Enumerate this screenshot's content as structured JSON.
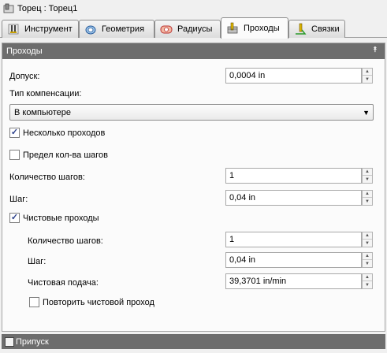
{
  "window": {
    "title": "Торец : Торец1"
  },
  "tabs": [
    {
      "label": "Инструмент",
      "icon": "tool-icon"
    },
    {
      "label": "Геометрия",
      "icon": "geometry-icon"
    },
    {
      "label": "Радиусы",
      "icon": "radius-icon"
    },
    {
      "label": "Проходы",
      "icon": "passes-icon",
      "active": true
    },
    {
      "label": "Связки",
      "icon": "links-icon"
    }
  ],
  "passes": {
    "header": "Проходы",
    "tolerance": {
      "label": "Допуск:",
      "value": "0,0004 in"
    },
    "compensation": {
      "label": "Тип компенсации:",
      "value": "В компьютере"
    },
    "multiple_passes": {
      "label": "Несколько проходов",
      "checked": true
    },
    "step_limit": {
      "label": "Предел кол-ва шагов",
      "checked": false
    },
    "step_count": {
      "label": "Количество шагов:",
      "value": "1"
    },
    "step": {
      "label": "Шаг:",
      "value": "0,04 in"
    },
    "finish_passes": {
      "label": "Чистовые проходы",
      "checked": true
    },
    "finish_step_count": {
      "label": "Количество шагов:",
      "value": "1"
    },
    "finish_step": {
      "label": "Шаг:",
      "value": "0,04 in"
    },
    "finish_feed": {
      "label": "Чистовая подача:",
      "value": "39,3701 in/min"
    },
    "repeat_finish": {
      "label": "Повторить чистовой проход",
      "checked": false
    }
  },
  "stock_panel": {
    "header": "Припуск",
    "checked": false
  }
}
